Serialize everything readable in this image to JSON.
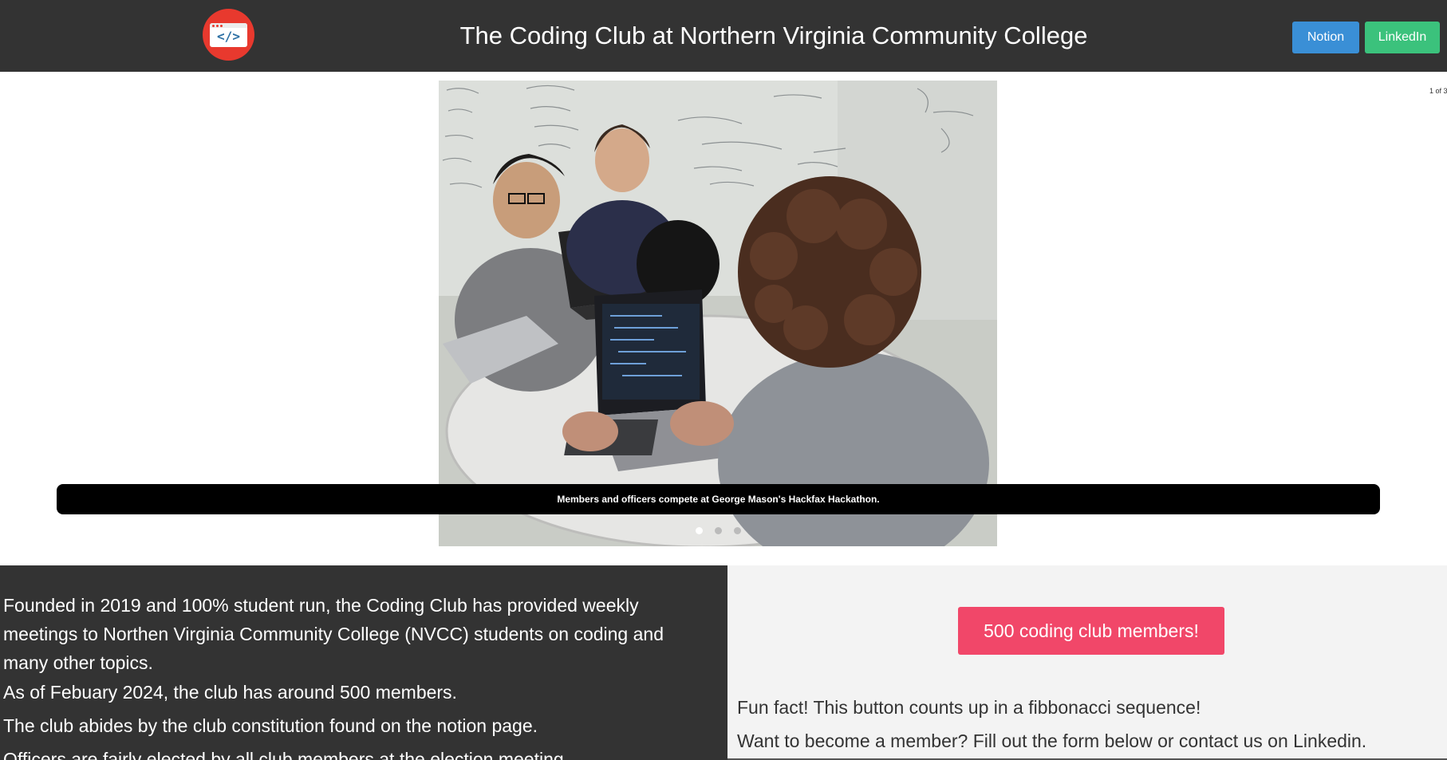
{
  "header": {
    "logo_text": "</>",
    "title": "The Coding Club at Northern Virginia Community College",
    "notion_label": "Notion",
    "linkedin_label": "LinkedIn"
  },
  "carousel": {
    "counter": "1 of 3",
    "caption": "Members and officers compete at George Mason's Hackfax Hackathon.",
    "slide_count": 3,
    "active_index": 0
  },
  "about": {
    "paragraphs": [
      "Founded in 2019 and 100% student run, the Coding Club has provided weekly meetings to Northen Virginia Community College (NVCC) students on coding and many other topics.",
      "As of Febuary 2024, the club has around 500 members.",
      "The club abides by the club constitution found on the notion page.",
      "Officers are fairly elected by all club members at the election meeting"
    ]
  },
  "members": {
    "button_label": "500 coding club members!",
    "fun_fact": "Fun fact! This button counts up in a fibbonacci sequence!",
    "join_text": "Want to become a member? Fill out the form below or contact us on Linkedin."
  },
  "colors": {
    "header_bg": "#333333",
    "logo_red": "#e8392e",
    "notion_blue": "#3a8fd6",
    "linkedin_green": "#3bc27c",
    "members_pink": "#f14769"
  }
}
